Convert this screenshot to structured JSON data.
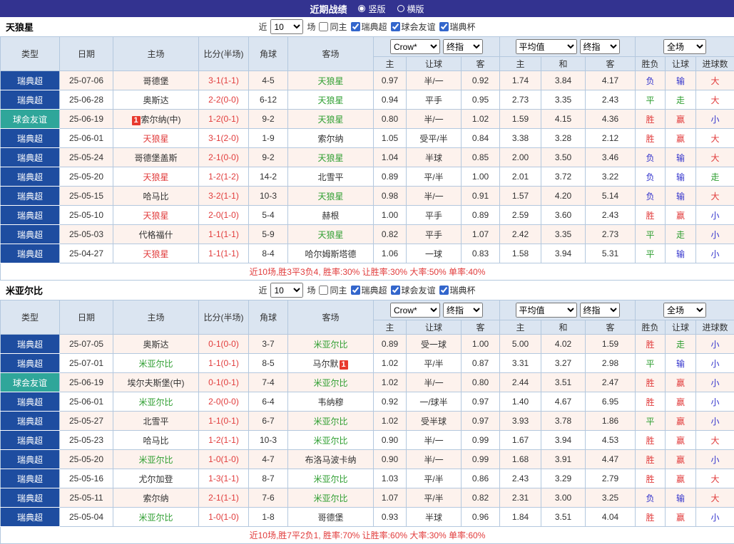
{
  "top_bar": {
    "title": "近期战绩",
    "layout_options": [
      {
        "label": "竖版",
        "selected": true
      },
      {
        "label": "横版",
        "selected": false
      }
    ]
  },
  "filter": {
    "prefix": "近",
    "count": "10",
    "suffix": "场",
    "checkboxes": [
      {
        "label": "同主",
        "checked": false
      },
      {
        "label": "瑞典超",
        "checked": true
      },
      {
        "label": "球会友谊",
        "checked": true
      },
      {
        "label": "瑞典杯",
        "checked": true
      }
    ]
  },
  "selects": {
    "book": "Crow*",
    "book_time": "终指",
    "avg": "平均值",
    "avg_time": "终指",
    "scope": "全场"
  },
  "columns": {
    "type": "类型",
    "date": "日期",
    "home": "主场",
    "score": "比分(半场)",
    "corners": "角球",
    "away": "客场",
    "odds_home": "主",
    "odds_handicap": "让球",
    "odds_away": "客",
    "avg_home": "主",
    "avg_draw": "和",
    "avg_away": "客",
    "result": "胜负",
    "handicap_result": "让球",
    "goals_result": "进球数"
  },
  "colors": {
    "top_bar": "#333390",
    "league_type": "#1e4da0",
    "friendly_type": "#2fa69a",
    "header_bg": "#dbe5f1",
    "row_alt_bg": "#fdf2ed",
    "red": "#e13b3b",
    "green": "#2e9e30",
    "blue": "#3333cc"
  },
  "sections": [
    {
      "team": "天狼星",
      "summary": "近10场,胜3平3负4, 胜率:30% 让胜率:30% 大率:50% 单率:40%",
      "rows": [
        {
          "type": "瑞典超",
          "type_style": "league",
          "date": "25-07-06",
          "home": "哥德堡",
          "home_color": "black",
          "score": "3-1(1-1)",
          "corners": "4-5",
          "away": "天狼星",
          "away_color": "green",
          "odds": [
            "0.97",
            "半/一",
            "0.92"
          ],
          "avg": [
            "1.74",
            "3.84",
            "4.17"
          ],
          "results": [
            [
              "负",
              "blue"
            ],
            [
              "输",
              "blue"
            ],
            [
              "大",
              "red"
            ]
          ]
        },
        {
          "type": "瑞典超",
          "type_style": "league",
          "date": "25-06-28",
          "home": "奥斯达",
          "home_color": "black",
          "score": "2-2(0-0)",
          "corners": "6-12",
          "away": "天狼星",
          "away_color": "green",
          "odds": [
            "0.94",
            "平手",
            "0.95"
          ],
          "avg": [
            "2.73",
            "3.35",
            "2.43"
          ],
          "results": [
            [
              "平",
              "green"
            ],
            [
              "走",
              "green"
            ],
            [
              "大",
              "red"
            ]
          ]
        },
        {
          "type": "球会友谊",
          "type_style": "friendly",
          "date": "25-06-19",
          "home": "索尔纳(中)",
          "home_color": "black",
          "home_badge": "1",
          "home_badge_pos": "before",
          "score": "1-2(0-1)",
          "corners": "9-2",
          "away": "天狼星",
          "away_color": "green",
          "odds": [
            "0.80",
            "半/一",
            "1.02"
          ],
          "avg": [
            "1.59",
            "4.15",
            "4.36"
          ],
          "results": [
            [
              "胜",
              "red"
            ],
            [
              "赢",
              "red"
            ],
            [
              "小",
              "blue"
            ]
          ]
        },
        {
          "type": "瑞典超",
          "type_style": "league",
          "date": "25-06-01",
          "home": "天狼星",
          "home_color": "red",
          "score": "3-1(2-0)",
          "corners": "1-9",
          "away": "索尔纳",
          "away_color": "black",
          "odds": [
            "1.05",
            "受平/半",
            "0.84"
          ],
          "avg": [
            "3.38",
            "3.28",
            "2.12"
          ],
          "results": [
            [
              "胜",
              "red"
            ],
            [
              "赢",
              "red"
            ],
            [
              "大",
              "red"
            ]
          ]
        },
        {
          "type": "瑞典超",
          "type_style": "league",
          "date": "25-05-24",
          "home": "哥德堡盖斯",
          "home_color": "black",
          "score": "2-1(0-0)",
          "corners": "9-2",
          "away": "天狼星",
          "away_color": "green",
          "odds": [
            "1.04",
            "半球",
            "0.85"
          ],
          "avg": [
            "2.00",
            "3.50",
            "3.46"
          ],
          "results": [
            [
              "负",
              "blue"
            ],
            [
              "输",
              "blue"
            ],
            [
              "大",
              "red"
            ]
          ]
        },
        {
          "type": "瑞典超",
          "type_style": "league",
          "date": "25-05-20",
          "home": "天狼星",
          "home_color": "red",
          "score": "1-2(1-2)",
          "corners": "14-2",
          "away": "北雪平",
          "away_color": "black",
          "odds": [
            "0.89",
            "平/半",
            "1.00"
          ],
          "avg": [
            "2.01",
            "3.72",
            "3.22"
          ],
          "results": [
            [
              "负",
              "blue"
            ],
            [
              "输",
              "blue"
            ],
            [
              "走",
              "green"
            ]
          ]
        },
        {
          "type": "瑞典超",
          "type_style": "league",
          "date": "25-05-15",
          "home": "哈马比",
          "home_color": "black",
          "score": "3-2(1-1)",
          "corners": "10-3",
          "away": "天狼星",
          "away_color": "green",
          "odds": [
            "0.98",
            "半/一",
            "0.91"
          ],
          "avg": [
            "1.57",
            "4.20",
            "5.14"
          ],
          "results": [
            [
              "负",
              "blue"
            ],
            [
              "输",
              "blue"
            ],
            [
              "大",
              "red"
            ]
          ]
        },
        {
          "type": "瑞典超",
          "type_style": "league",
          "date": "25-05-10",
          "home": "天狼星",
          "home_color": "red",
          "score": "2-0(1-0)",
          "corners": "5-4",
          "away": "赫根",
          "away_color": "black",
          "odds": [
            "1.00",
            "平手",
            "0.89"
          ],
          "avg": [
            "2.59",
            "3.60",
            "2.43"
          ],
          "results": [
            [
              "胜",
              "red"
            ],
            [
              "赢",
              "red"
            ],
            [
              "小",
              "blue"
            ]
          ]
        },
        {
          "type": "瑞典超",
          "type_style": "league",
          "date": "25-05-03",
          "home": "代格福什",
          "home_color": "black",
          "score": "1-1(1-1)",
          "corners": "5-9",
          "away": "天狼星",
          "away_color": "green",
          "odds": [
            "0.82",
            "平手",
            "1.07"
          ],
          "avg": [
            "2.42",
            "3.35",
            "2.73"
          ],
          "results": [
            [
              "平",
              "green"
            ],
            [
              "走",
              "green"
            ],
            [
              "小",
              "blue"
            ]
          ]
        },
        {
          "type": "瑞典超",
          "type_style": "league",
          "date": "25-04-27",
          "home": "天狼星",
          "home_color": "red",
          "score": "1-1(1-1)",
          "corners": "8-4",
          "away": "哈尔姆斯塔德",
          "away_color": "black",
          "odds": [
            "1.06",
            "一球",
            "0.83"
          ],
          "avg": [
            "1.58",
            "3.94",
            "5.31"
          ],
          "results": [
            [
              "平",
              "green"
            ],
            [
              "输",
              "blue"
            ],
            [
              "小",
              "blue"
            ]
          ]
        }
      ]
    },
    {
      "team": "米亚尔比",
      "summary": "近10场,胜7平2负1, 胜率:70% 让胜率:60% 大率:30% 单率:60%",
      "rows": [
        {
          "type": "瑞典超",
          "type_style": "league",
          "date": "25-07-05",
          "home": "奥斯达",
          "home_color": "black",
          "score": "0-1(0-0)",
          "corners": "3-7",
          "away": "米亚尔比",
          "away_color": "green",
          "odds": [
            "0.89",
            "受一球",
            "1.00"
          ],
          "avg": [
            "5.00",
            "4.02",
            "1.59"
          ],
          "results": [
            [
              "胜",
              "red"
            ],
            [
              "走",
              "green"
            ],
            [
              "小",
              "blue"
            ]
          ]
        },
        {
          "type": "瑞典超",
          "type_style": "league",
          "date": "25-07-01",
          "home": "米亚尔比",
          "home_color": "green",
          "score": "1-1(0-1)",
          "corners": "8-5",
          "away": "马尔默",
          "away_color": "black",
          "away_badge": "1",
          "away_badge_pos": "after",
          "odds": [
            "1.02",
            "平/半",
            "0.87"
          ],
          "avg": [
            "3.31",
            "3.27",
            "2.98"
          ],
          "results": [
            [
              "平",
              "green"
            ],
            [
              "输",
              "blue"
            ],
            [
              "小",
              "blue"
            ]
          ]
        },
        {
          "type": "球会友谊",
          "type_style": "friendly",
          "date": "25-06-19",
          "home": "埃尔夫斯堡(中)",
          "home_color": "black",
          "score": "0-1(0-1)",
          "corners": "7-4",
          "away": "米亚尔比",
          "away_color": "green",
          "odds": [
            "1.02",
            "半/一",
            "0.80"
          ],
          "avg": [
            "2.44",
            "3.51",
            "2.47"
          ],
          "results": [
            [
              "胜",
              "red"
            ],
            [
              "赢",
              "red"
            ],
            [
              "小",
              "blue"
            ]
          ]
        },
        {
          "type": "瑞典超",
          "type_style": "league",
          "date": "25-06-01",
          "home": "米亚尔比",
          "home_color": "green",
          "score": "2-0(0-0)",
          "corners": "6-4",
          "away": "韦纳穆",
          "away_color": "black",
          "odds": [
            "0.92",
            "一/球半",
            "0.97"
          ],
          "avg": [
            "1.40",
            "4.67",
            "6.95"
          ],
          "results": [
            [
              "胜",
              "red"
            ],
            [
              "赢",
              "red"
            ],
            [
              "小",
              "blue"
            ]
          ]
        },
        {
          "type": "瑞典超",
          "type_style": "league",
          "date": "25-05-27",
          "home": "北雪平",
          "home_color": "black",
          "score": "1-1(0-1)",
          "corners": "6-7",
          "away": "米亚尔比",
          "away_color": "green",
          "odds": [
            "1.02",
            "受半球",
            "0.97"
          ],
          "avg": [
            "3.93",
            "3.78",
            "1.86"
          ],
          "results": [
            [
              "平",
              "green"
            ],
            [
              "赢",
              "red"
            ],
            [
              "小",
              "blue"
            ]
          ]
        },
        {
          "type": "瑞典超",
          "type_style": "league",
          "date": "25-05-23",
          "home": "哈马比",
          "home_color": "black",
          "score": "1-2(1-1)",
          "corners": "10-3",
          "away": "米亚尔比",
          "away_color": "green",
          "odds": [
            "0.90",
            "半/一",
            "0.99"
          ],
          "avg": [
            "1.67",
            "3.94",
            "4.53"
          ],
          "results": [
            [
              "胜",
              "red"
            ],
            [
              "赢",
              "red"
            ],
            [
              "大",
              "red"
            ]
          ]
        },
        {
          "type": "瑞典超",
          "type_style": "league",
          "date": "25-05-20",
          "home": "米亚尔比",
          "home_color": "green",
          "score": "1-0(1-0)",
          "corners": "4-7",
          "away": "布洛马波卡纳",
          "away_color": "black",
          "odds": [
            "0.90",
            "半/一",
            "0.99"
          ],
          "avg": [
            "1.68",
            "3.91",
            "4.47"
          ],
          "results": [
            [
              "胜",
              "red"
            ],
            [
              "赢",
              "red"
            ],
            [
              "小",
              "blue"
            ]
          ]
        },
        {
          "type": "瑞典超",
          "type_style": "league",
          "date": "25-05-16",
          "home": "尤尔加登",
          "home_color": "black",
          "score": "1-3(1-1)",
          "corners": "8-7",
          "away": "米亚尔比",
          "away_color": "green",
          "odds": [
            "1.03",
            "平/半",
            "0.86"
          ],
          "avg": [
            "2.43",
            "3.29",
            "2.79"
          ],
          "results": [
            [
              "胜",
              "red"
            ],
            [
              "赢",
              "red"
            ],
            [
              "大",
              "red"
            ]
          ]
        },
        {
          "type": "瑞典超",
          "type_style": "league",
          "date": "25-05-11",
          "home": "索尔纳",
          "home_color": "black",
          "score": "2-1(1-1)",
          "corners": "7-6",
          "away": "米亚尔比",
          "away_color": "green",
          "odds": [
            "1.07",
            "平/半",
            "0.82"
          ],
          "avg": [
            "2.31",
            "3.00",
            "3.25"
          ],
          "results": [
            [
              "负",
              "blue"
            ],
            [
              "输",
              "blue"
            ],
            [
              "大",
              "red"
            ]
          ]
        },
        {
          "type": "瑞典超",
          "type_style": "league",
          "date": "25-05-04",
          "home": "米亚尔比",
          "home_color": "green",
          "score": "1-0(1-0)",
          "corners": "1-8",
          "away": "哥德堡",
          "away_color": "black",
          "odds": [
            "0.93",
            "半球",
            "0.96"
          ],
          "avg": [
            "1.84",
            "3.51",
            "4.04"
          ],
          "results": [
            [
              "胜",
              "red"
            ],
            [
              "赢",
              "red"
            ],
            [
              "小",
              "blue"
            ]
          ]
        }
      ]
    }
  ]
}
